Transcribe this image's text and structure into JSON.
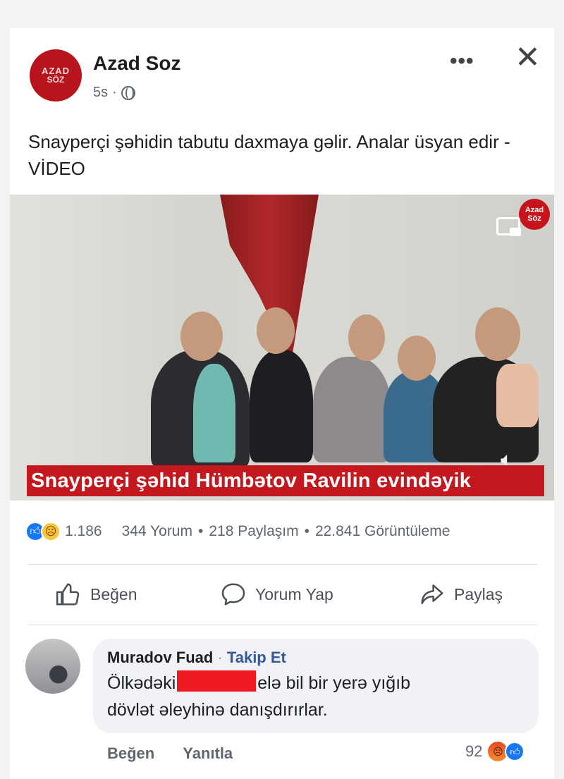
{
  "post": {
    "page_name": "Azad Soz",
    "logo_top": "AZAD",
    "logo_bottom": "SÖZ",
    "time": "5s",
    "separator": "·",
    "text": "Snayperçi şəhidin tabutu daxmaya gəlir. Analar üsyan edir - VİDEO"
  },
  "video": {
    "badge_line1": "Azad",
    "badge_line2": "Söz",
    "caption": "Snayperçi şəhid Hümbətov Ravilin evindəyik"
  },
  "stats": {
    "reactions_count": "1.186",
    "comments": "344 Yorum",
    "dot": "•",
    "shares": "218 Paylaşım",
    "views": "22.841 Görüntüleme"
  },
  "actions": {
    "like": "Beğen",
    "comment": "Yorum Yap",
    "share": "Paylaş"
  },
  "comment": {
    "author": "Muradov Fuad",
    "follow": "Takip Et",
    "follow_sep": "·",
    "text_before": "Ölkədəki",
    "text_after": "elə bil bir yerə yığıb",
    "text_line2": "dövlət əleyhinə danışdırırlar.",
    "like": "Beğen",
    "reply": "Yanıtla",
    "reaction_count": "92"
  },
  "colors": {
    "brand_red": "#c4171e",
    "facebook_blue": "#1877f2",
    "link_blue": "#385898",
    "redaction_red": "#f01822"
  }
}
